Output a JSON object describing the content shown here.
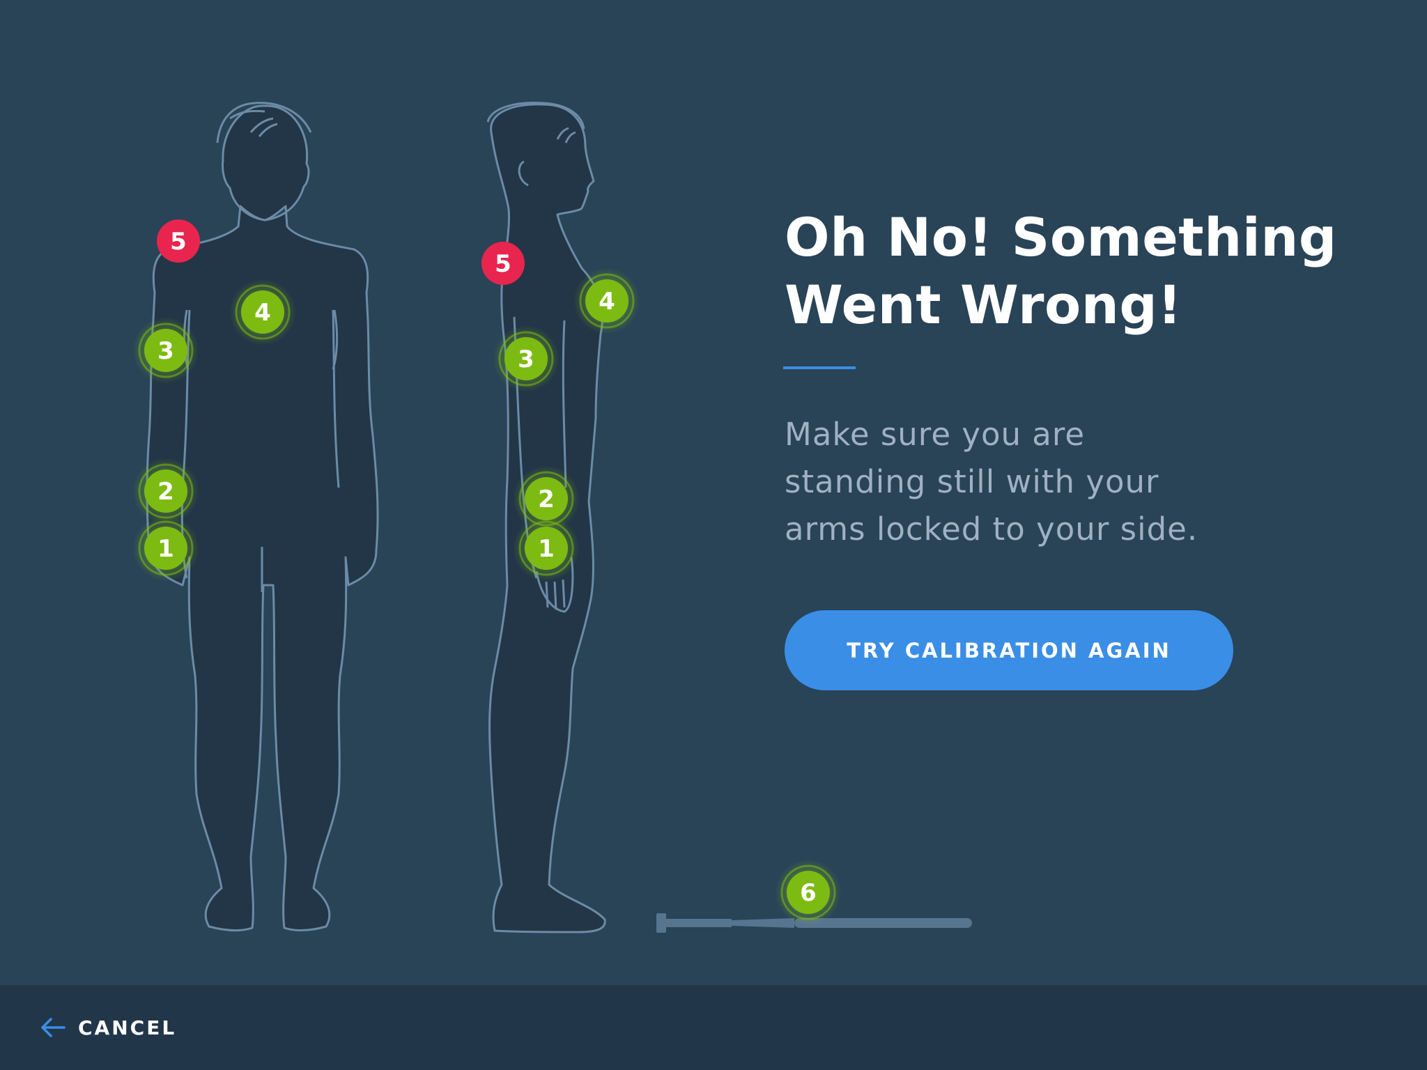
{
  "dialog": {
    "title_line1": "Oh No! Something",
    "title_line2": "Went Wrong!",
    "message_line1": "Make sure you are",
    "message_line2": "standing still with your",
    "message_line3": "arms locked to your side.",
    "retry_label": "TRY CALIBRATION AGAIN"
  },
  "markers": {
    "front": [
      "1",
      "2",
      "3",
      "4",
      "5"
    ],
    "side": [
      "1",
      "2",
      "3",
      "4",
      "5"
    ],
    "floor": "6"
  },
  "marker_status": {
    "1": "ok",
    "2": "ok",
    "3": "ok",
    "4": "ok",
    "5": "error",
    "6": "ok"
  },
  "footer": {
    "cancel_label": "CANCEL",
    "cancel_icon": "arrow-left-icon"
  },
  "colors": {
    "background": "#294357",
    "footer_background": "#22364a",
    "accent": "#3a8ee6",
    "marker_ok": "#7dbb12",
    "marker_error": "#e8254e",
    "outline": "#6c8ba6",
    "body_fill": "#223647"
  }
}
